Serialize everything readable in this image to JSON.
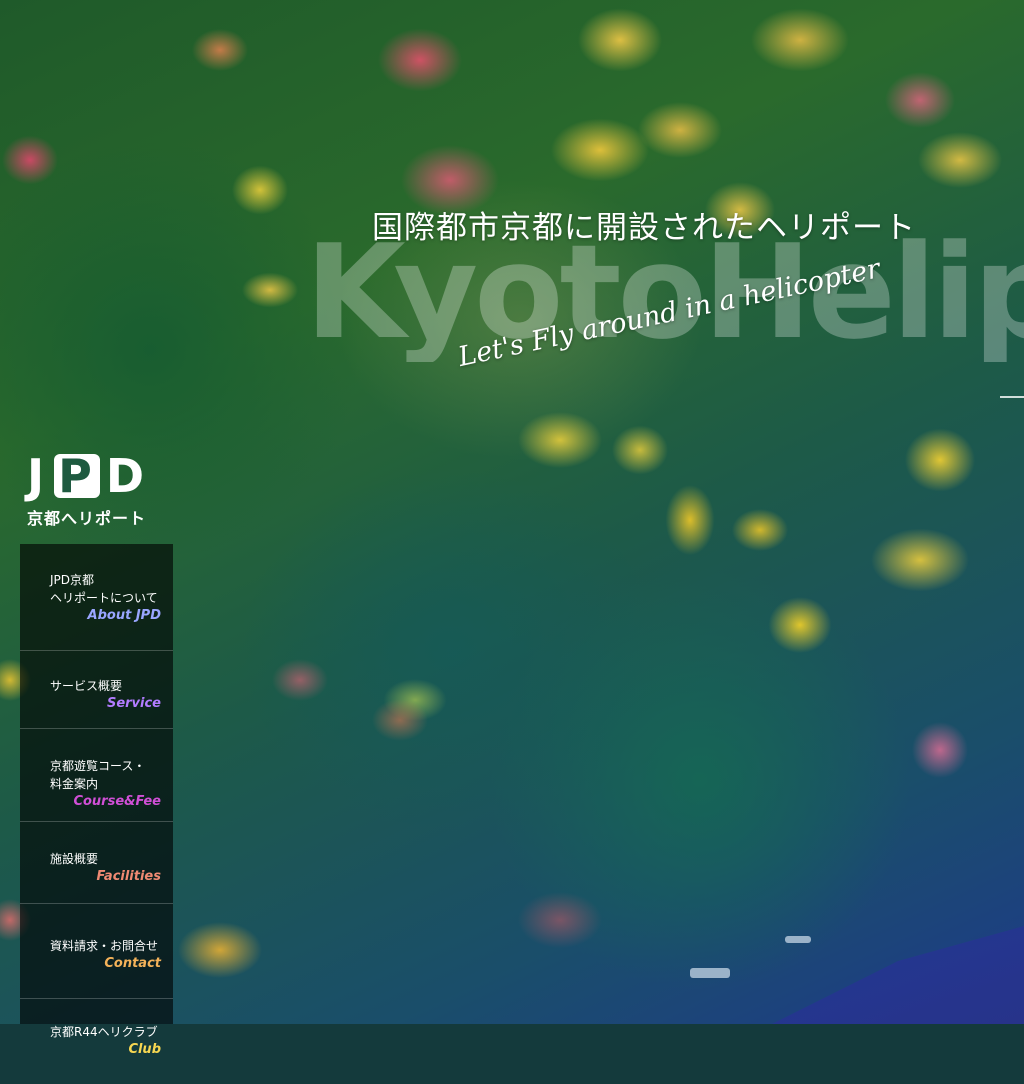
{
  "hero": {
    "headline": "国際都市京都に開設されたヘリポート",
    "watermark": "KyotoHeliport",
    "tagline": "Let's Fly around in a helicopter"
  },
  "logo": {
    "mark_left": "J",
    "mark_middle": "P",
    "mark_right": "D",
    "subtitle": "京都へリポート"
  },
  "menu": {
    "items": [
      {
        "jp": "JPD京都\nヘリポートについて",
        "en": "About JPD",
        "color": "#9aa6ff"
      },
      {
        "jp": "サービス概要",
        "en": "Service",
        "color": "#b27cff"
      },
      {
        "jp": "京都遊覧コース・\n料金案内",
        "en": "Course&Fee",
        "color": "#d04fd6"
      },
      {
        "jp": "施設概要",
        "en": "Facilities",
        "color": "#f08a73"
      },
      {
        "jp": "資料請求・お問合せ",
        "en": "Contact",
        "color": "#f4b259"
      },
      {
        "jp": "京都R44ヘリクラブ",
        "en": "Club",
        "color": "#f6d651"
      }
    ]
  },
  "colors": {
    "menu_bg": "#000000",
    "logo_text": "#ffffff"
  }
}
